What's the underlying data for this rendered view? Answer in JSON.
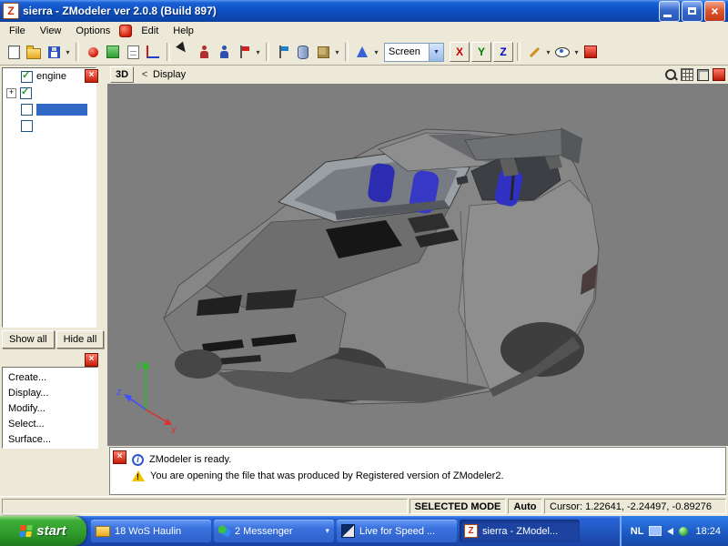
{
  "window": {
    "title": "sierra - ZModeler ver 2.0.8 (Build 897)",
    "app_icon_letter": "Z"
  },
  "menu": {
    "items": [
      "File",
      "View",
      "Options",
      "Edit",
      "Help"
    ]
  },
  "toolbar": {
    "screen_dropdown_value": "Screen",
    "axis_x": "X",
    "axis_y": "Y",
    "axis_z": "Z",
    "icons": [
      "new-file",
      "open-file",
      "save-file",
      "import-tool",
      "materials",
      "notes",
      "local-axes",
      "select-arrow",
      "vertices-mode",
      "edges-mode",
      "polygons-mode",
      "objects-mode",
      "create-flag",
      "cylinder-primitive",
      "box-primitive",
      "cone-primitive",
      "draw-tool",
      "view-tool",
      "extra-tool"
    ]
  },
  "viewport": {
    "mode_button": "3D",
    "back_arrow": "<",
    "view_label": "Display"
  },
  "scene_tree": {
    "items": [
      {
        "label": "engine",
        "checked": true
      },
      {
        "label": "",
        "checked": true,
        "expander": "+"
      },
      {
        "label": "",
        "checked": false,
        "selected": true
      },
      {
        "label": "",
        "checked": false
      }
    ],
    "show_all": "Show all",
    "hide_all": "Hide all"
  },
  "command_panel": {
    "items": [
      "Create...",
      "Display...",
      "Modify...",
      "Select...",
      "Surface..."
    ]
  },
  "messages": {
    "lines": [
      {
        "icon": "info",
        "text": "ZModeler is ready."
      },
      {
        "icon": "warning",
        "text": "You are opening the file that was produced by Registered version of ZModeler2."
      }
    ]
  },
  "status_bar": {
    "selected_mode": "SELECTED MODE",
    "auto": "Auto",
    "cursor": "Cursor: 1.22641, -2.24497, -0.89276"
  },
  "taskbar": {
    "start_label": "start",
    "items": [
      {
        "label": "18 WoS Haulin"
      },
      {
        "label": "2 Messenger"
      },
      {
        "label": "Live for Speed ..."
      },
      {
        "label": "sierra - ZModel...",
        "active": true
      }
    ],
    "tray": {
      "language": "NL",
      "time": "18:24"
    }
  }
}
